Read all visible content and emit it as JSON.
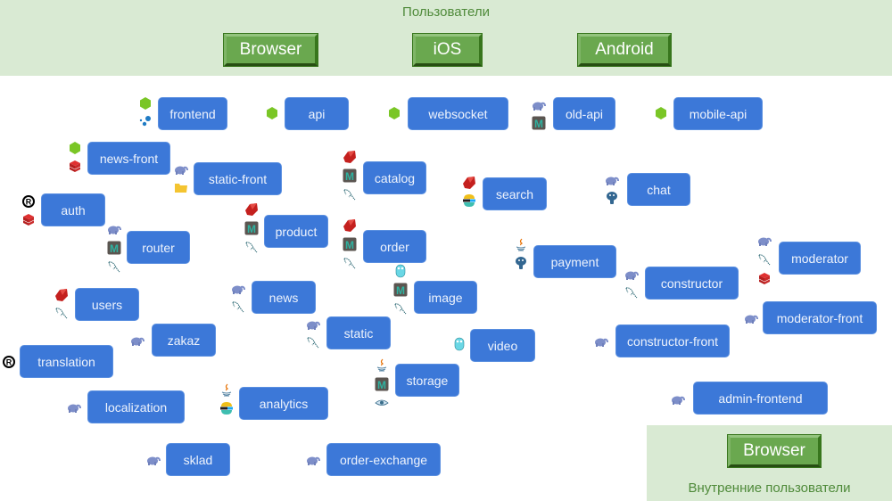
{
  "users_band": {
    "title": "Пользователи",
    "clients": [
      "Browser",
      "iOS",
      "Android"
    ]
  },
  "internal_band": {
    "title": "Внутренние пользователи",
    "clients": [
      "Browser"
    ]
  },
  "icon_legend": {
    "node": "nodejs-icon",
    "docker": "docker-icon",
    "php": "php-elephant-icon",
    "memcached": "memcached-icon",
    "redis": "redis-icon",
    "rust": "rust-icon",
    "ruby": "ruby-icon",
    "mysql": "mysql-dolphin-icon",
    "folder": "folder-icon",
    "elastic": "elasticsearch-icon",
    "postgres": "postgresql-icon",
    "java": "java-icon",
    "go": "go-gopher-icon",
    "eye": "eye-icon"
  },
  "colors": {
    "service_box": "#3c78d8",
    "band_bg": "#d9ead3",
    "client_button": "#6aa84f",
    "band_text": "#4f8a3a"
  },
  "services": [
    {
      "name": "frontend",
      "icons": [
        "node",
        "docker"
      ]
    },
    {
      "name": "api",
      "icons": [
        "node"
      ]
    },
    {
      "name": "websocket",
      "icons": [
        "node"
      ]
    },
    {
      "name": "old-api",
      "icons": [
        "php",
        "memcached"
      ]
    },
    {
      "name": "mobile-api",
      "icons": [
        "node"
      ]
    },
    {
      "name": "news-front",
      "icons": [
        "node",
        "redis"
      ]
    },
    {
      "name": "static-front",
      "icons": [
        "php",
        "folder"
      ]
    },
    {
      "name": "catalog",
      "icons": [
        "ruby",
        "memcached",
        "mysql"
      ]
    },
    {
      "name": "search",
      "icons": [
        "ruby",
        "elastic"
      ]
    },
    {
      "name": "chat",
      "icons": [
        "php",
        "postgres"
      ]
    },
    {
      "name": "auth",
      "icons": [
        "rust",
        "redis"
      ]
    },
    {
      "name": "product",
      "icons": [
        "ruby",
        "memcached",
        "mysql"
      ]
    },
    {
      "name": "router",
      "icons": [
        "php",
        "memcached",
        "mysql"
      ]
    },
    {
      "name": "order",
      "icons": [
        "ruby",
        "memcached",
        "mysql"
      ]
    },
    {
      "name": "payment",
      "icons": [
        "java",
        "postgres"
      ]
    },
    {
      "name": "moderator",
      "icons": [
        "php",
        "mysql",
        "redis"
      ]
    },
    {
      "name": "constructor",
      "icons": [
        "php",
        "mysql"
      ]
    },
    {
      "name": "users",
      "icons": [
        "ruby",
        "mysql"
      ]
    },
    {
      "name": "news",
      "icons": [
        "php",
        "mysql"
      ]
    },
    {
      "name": "image",
      "icons": [
        "go",
        "memcached",
        "mysql"
      ]
    },
    {
      "name": "moderator-front",
      "icons": [
        "php"
      ]
    },
    {
      "name": "zakaz",
      "icons": [
        "php"
      ]
    },
    {
      "name": "static",
      "icons": [
        "php",
        "mysql"
      ]
    },
    {
      "name": "video",
      "icons": [
        "go"
      ]
    },
    {
      "name": "constructor-front",
      "icons": [
        "php"
      ]
    },
    {
      "name": "translation",
      "icons": [
        "rust"
      ]
    },
    {
      "name": "storage",
      "icons": [
        "java",
        "memcached",
        "eye"
      ]
    },
    {
      "name": "localization",
      "icons": [
        "php"
      ]
    },
    {
      "name": "analytics",
      "icons": [
        "java",
        "elastic"
      ]
    },
    {
      "name": "admin-frontend",
      "icons": [
        "php"
      ]
    },
    {
      "name": "sklad",
      "icons": [
        "php"
      ]
    },
    {
      "name": "order-exchange",
      "icons": [
        "php"
      ]
    }
  ]
}
